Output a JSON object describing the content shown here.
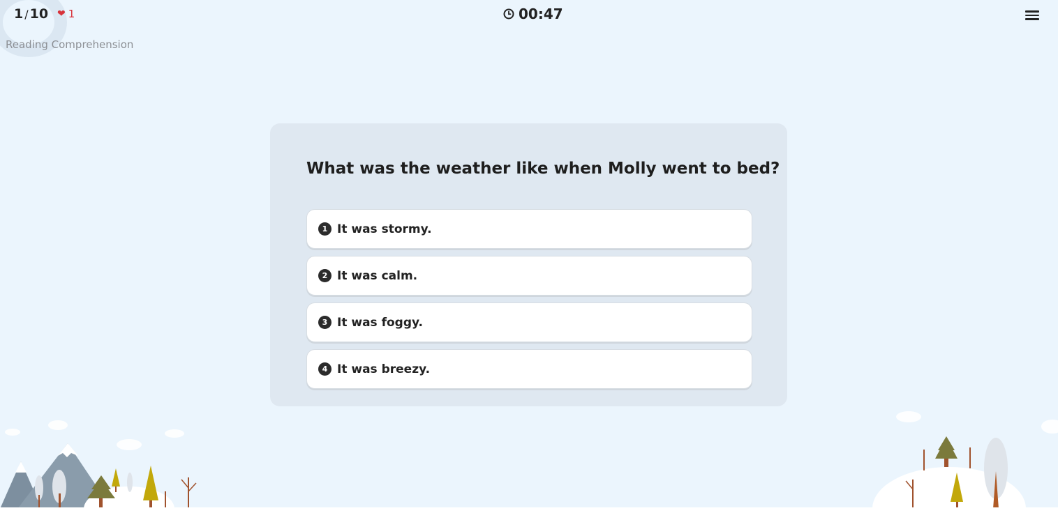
{
  "header": {
    "progress_current": "1",
    "progress_separator": "/",
    "progress_total": "10",
    "lives_icon": "heart-icon",
    "lives_count": "1",
    "subject": "Reading Comprehension",
    "timer_icon": "clock-icon",
    "timer": "00:47",
    "menu_icon": "hamburger-menu-icon"
  },
  "quiz": {
    "question": "What was the weather like when Molly went to bed?",
    "options": [
      {
        "number": "1",
        "label": "It was stormy."
      },
      {
        "number": "2",
        "label": "It was calm."
      },
      {
        "number": "3",
        "label": "It was foggy."
      },
      {
        "number": "4",
        "label": "It was breezy."
      }
    ]
  },
  "colors": {
    "background": "#ebf5fd",
    "card": "#dfe8f1",
    "heart": "#d8323a",
    "number_badge": "#2b2b2b"
  }
}
